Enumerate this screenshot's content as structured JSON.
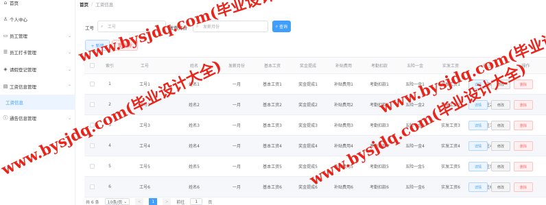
{
  "sidebar": {
    "items": [
      {
        "label": "首页",
        "icon": "home-icon"
      },
      {
        "label": "个人中心",
        "icon": "user-icon"
      },
      {
        "label": "员工管理",
        "icon": "briefcase-icon"
      },
      {
        "label": "员工打卡管理",
        "icon": "list-icon"
      },
      {
        "label": "请假登记管理",
        "icon": "layers-icon"
      },
      {
        "label": "工资信息管理",
        "icon": "document-icon"
      },
      {
        "label": "通告信息管理",
        "icon": "info-icon"
      }
    ],
    "active_sub": "工资信息"
  },
  "breadcrumb": {
    "home": "首页",
    "separator": "/",
    "current": "工资信息"
  },
  "search": {
    "employee_id_label": "工号",
    "employee_id_placeholder": "工号",
    "month_label": "发薪月份",
    "month_placeholder": "发薪月份",
    "query_label": "查询"
  },
  "actions": {
    "add_label": "+ 新增",
    "delete_label": "删除"
  },
  "table": {
    "columns": [
      "索引",
      "工号",
      "姓名",
      "发薪月份",
      "基本工资",
      "奖金提成",
      "补贴费用",
      "考勤扣款",
      "五险一金",
      "实发工资",
      "备注",
      "操作"
    ],
    "rows": [
      [
        "1",
        "工号1",
        "姓名1",
        "一月",
        "基本工资1",
        "奖金提成1",
        "补贴费用1",
        "考勤扣款1",
        "五险一金1",
        "实发工资1",
        "备注1"
      ],
      [
        "2",
        "工号2",
        "姓名2",
        "一月",
        "基本工资2",
        "奖金提成2",
        "补贴费用2",
        "考勤扣款2",
        "五险一金2",
        "实发工资2",
        "备注2"
      ],
      [
        "3",
        "工号3",
        "姓名3",
        "一月",
        "基本工资3",
        "奖金提成3",
        "补贴费用3",
        "考勤扣款3",
        "五险一金3",
        "实发工资3",
        "备注3"
      ],
      [
        "4",
        "工号4",
        "姓名4",
        "一月",
        "基本工资4",
        "奖金提成4",
        "补贴费用4",
        "考勤扣款4",
        "五险一金4",
        "实发工资4",
        "备注4"
      ],
      [
        "5",
        "工号5",
        "姓名5",
        "一月",
        "基本工资5",
        "奖金提成5",
        "补贴费用5",
        "考勤扣款5",
        "五险一金5",
        "实发工资5",
        "备注5"
      ],
      [
        "6",
        "工号6",
        "姓名6",
        "一月",
        "基本工资6",
        "奖金提成6",
        "补贴费用6",
        "考勤扣款6",
        "五险一金6",
        "实发工资6",
        "备注6"
      ]
    ],
    "op_labels": {
      "detail": "详情",
      "edit": "修改",
      "delete": "删除"
    }
  },
  "pagination": {
    "total": "共 6 条",
    "page_size": "10条/页",
    "prev": "<",
    "current": "1",
    "next": ">",
    "goto_label": "前往",
    "goto_value": "1",
    "goto_suffix": "页"
  },
  "watermark": {
    "text": "www.bysjdq.com(毕业设计大全)",
    "color": "#e8241b"
  }
}
